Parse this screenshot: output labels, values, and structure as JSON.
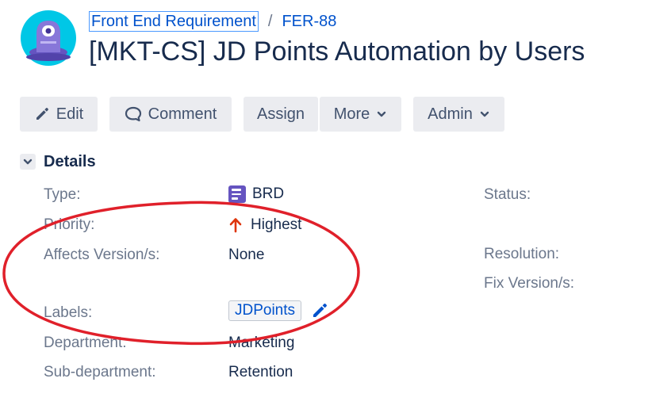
{
  "breadcrumb": {
    "project": "Front End Requirement",
    "separator": "/",
    "issue_key": "FER-88"
  },
  "issue": {
    "title": "[MKT-CS] JD Points Automation by Users"
  },
  "toolbar": {
    "edit": "Edit",
    "comment": "Comment",
    "assign": "Assign",
    "more": "More",
    "admin": "Admin"
  },
  "details": {
    "title": "Details",
    "fields": {
      "type": {
        "label": "Type:",
        "value": "BRD"
      },
      "priority": {
        "label": "Priority:",
        "value": "Highest"
      },
      "affects_version": {
        "label": "Affects Version/s:",
        "value": "None"
      },
      "labels": {
        "label": "Labels:",
        "values": [
          "JDPoints"
        ]
      },
      "department": {
        "label": "Department:",
        "value": "Marketing"
      },
      "sub_department": {
        "label": "Sub-department:",
        "value": "Retention"
      },
      "status": {
        "label": "Status:"
      },
      "resolution": {
        "label": "Resolution:"
      },
      "fix_version": {
        "label": "Fix Version/s:"
      }
    }
  },
  "icons": {
    "avatar": "project-avatar-icon",
    "edit": "pencil-icon",
    "comment": "comment-bubble-icon",
    "dropdown": "chevron-down-icon",
    "type": "document-icon",
    "priority": "arrow-up-icon",
    "edit_labels": "pencil-icon"
  },
  "colors": {
    "link": "#0052cc",
    "text": "#172b4d",
    "label": "#6b778c",
    "button_bg": "#ebecf0",
    "type_icon": "#6554c0",
    "priority_highest": "#de350b",
    "annotation": "#e0202a"
  }
}
